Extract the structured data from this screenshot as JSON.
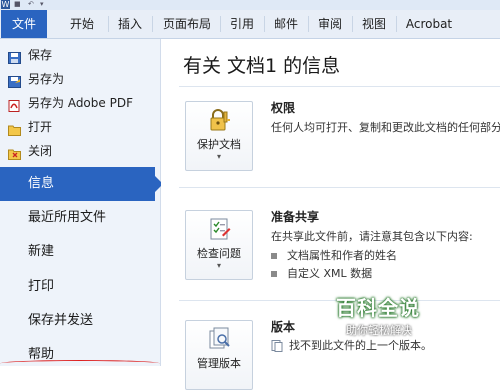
{
  "titlebar": {
    "app_icon_letter": "W"
  },
  "ribbon": {
    "tabs": [
      {
        "label": "文件"
      },
      {
        "label": "开始"
      },
      {
        "label": "插入"
      },
      {
        "label": "页面布局"
      },
      {
        "label": "引用"
      },
      {
        "label": "邮件"
      },
      {
        "label": "审阅"
      },
      {
        "label": "视图"
      },
      {
        "label": "Acrobat"
      }
    ]
  },
  "sidebar": {
    "small_items": [
      {
        "label": "保存",
        "icon": "save-icon"
      },
      {
        "label": "另存为",
        "icon": "save-as-icon"
      },
      {
        "label": "另存为 Adobe PDF",
        "icon": "pdf-icon"
      },
      {
        "label": "打开",
        "icon": "folder-open-icon"
      },
      {
        "label": "关闭",
        "icon": "close-doc-icon"
      }
    ],
    "big_items": [
      {
        "label": "信息",
        "active": true
      },
      {
        "label": "最近所用文件"
      },
      {
        "label": "新建"
      },
      {
        "label": "打印"
      },
      {
        "label": "保存并发送"
      },
      {
        "label": "帮助"
      }
    ]
  },
  "main": {
    "title": "有关 文档1 的信息",
    "sections": [
      {
        "button_label": "保护文档",
        "button_icon": "lock-key-icon",
        "heading": "权限",
        "text": "任何人均可打开、复制和更改此文档的任何部分"
      },
      {
        "button_label": "检查问题",
        "button_icon": "checklist-icon",
        "heading": "准备共享",
        "text": "在共享此文件前，请注意其包含以下内容:",
        "bullets": [
          "文档属性和作者的姓名",
          "自定义 XML 数据"
        ]
      },
      {
        "button_label": "管理版本",
        "button_icon": "versions-icon",
        "heading": "版本",
        "text": "找不到此文件的上一个版本。"
      }
    ]
  },
  "watermark": {
    "title": "百科全说",
    "subtitle": "助你轻松解决"
  },
  "colors": {
    "accent": "#2a64c0",
    "sidebar_bg": "#eef3fa",
    "ribbon_bg": "#e8eef7"
  }
}
